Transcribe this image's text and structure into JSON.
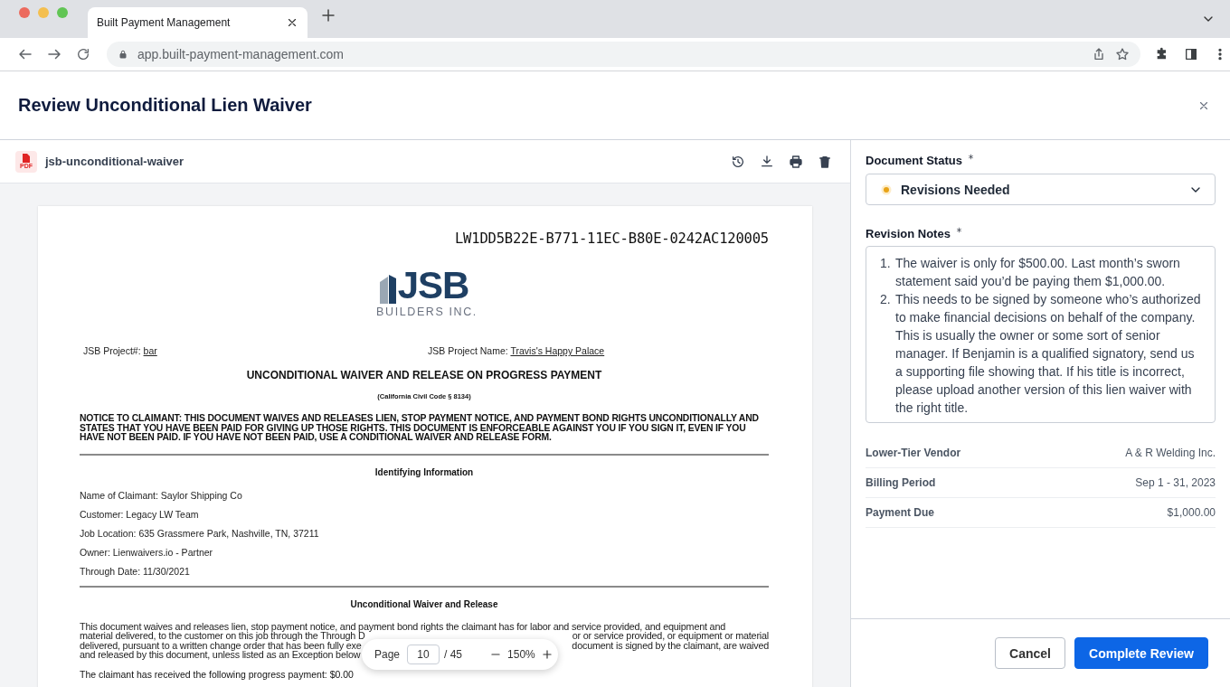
{
  "browser": {
    "tab_title": "Built Payment Management",
    "url": "app.built-payment-management.com"
  },
  "header": {
    "title": "Review Unconditional Lien Waiver"
  },
  "file": {
    "name": "jsb-unconditional-waiver",
    "icon_label": "PDF"
  },
  "document": {
    "id": "LW1DD5B22E-B771-11EC-B80E-0242AC120005",
    "logo_main": "JSB",
    "logo_sub": "BUILDERS INC.",
    "project_number": {
      "label": "JSB Project#:",
      "value": "bar"
    },
    "project_name": {
      "label": "JSB Project Name:",
      "value": "Travis's Happy Palace"
    },
    "title": "UNCONDITIONAL WAIVER AND RELEASE ON PROGRESS PAYMENT",
    "code": "(California Civil Code § 8134)",
    "notice": "NOTICE TO CLAIMANT: THIS DOCUMENT WAIVES AND RELEASES LIEN, STOP PAYMENT NOTICE, AND PAYMENT BOND RIGHTS UNCONDITIONALLY AND STATES THAT YOU HAVE BEEN PAID FOR GIVING UP THOSE RIGHTS. THIS DOCUMENT IS ENFORCEABLE AGAINST YOU IF YOU SIGN IT, EVEN IF YOU HAVE NOT BEEN PAID. IF YOU HAVE NOT BEEN PAID, USE A CONDITIONAL WAIVER AND RELEASE FORM.",
    "identifying_heading": "Identifying Information",
    "identifying_lines": [
      "Name of Claimant: Saylor Shipping Co",
      "Customer: Legacy LW Team",
      "Job Location: 635 Grassmere Park, Nashville, TN, 37211",
      "Owner: Lienwaivers.io - Partner",
      "Through Date: 11/30/2021"
    ],
    "waiver_heading": "Unconditional Waiver and Release",
    "paragraph_lines": [
      {
        "segments": [
          "This document waives and releases lien, stop payment notice, and payment bond rights the claimant has for labor and service provided, and equipment and"
        ]
      },
      {
        "segments": [
          "material delivered, to the customer on this job through the Through D",
          "or or service provided, or equipment or material"
        ]
      },
      {
        "segments": [
          "delivered, pursuant to a written change order that has been fully exe",
          "document is signed by the claimant, are waived"
        ]
      },
      {
        "segments": [
          "and released by this document, unless listed as an Exception below"
        ]
      }
    ],
    "payment_line": "The claimant has received the following progress payment: $0.00"
  },
  "pager": {
    "label": "Page",
    "page": "10",
    "total": "/ 45",
    "zoom": "150%"
  },
  "form": {
    "status_label": "Document Status",
    "status_value": "Revisions Needed",
    "notes_label": "Revision Notes",
    "note_markers": [
      "1.",
      "2."
    ],
    "notes": [
      "The waiver is only for $500.00. Last month’s sworn statement said you’d be paying them $1,000.00.",
      "This needs to be signed by someone who’s authorized to make financial decisions on behalf of the company. This is usually the owner or some sort of senior manager. If Benjamin is a qualified signatory, send us a supporting file showing that. If his title is incorrect, please upload another version of this lien waiver with the right title."
    ],
    "details": [
      {
        "label": "Lower-Tier Vendor",
        "value": "A & R Welding Inc."
      },
      {
        "label": "Billing Period",
        "value": "Sep 1 - 31, 2023"
      },
      {
        "label": "Payment Due",
        "value": "$1,000.00"
      }
    ]
  },
  "buttons": {
    "cancel": "Cancel",
    "submit": "Complete Review"
  }
}
